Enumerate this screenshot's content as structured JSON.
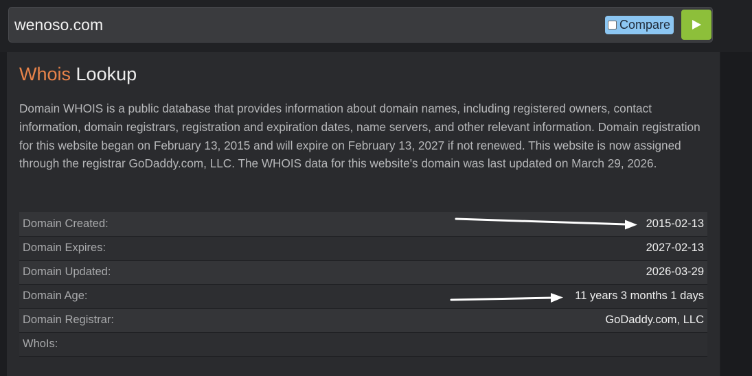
{
  "search": {
    "value": "wenoso.com",
    "compare_label": "Compare",
    "compare_checked": false,
    "go_icon": "play-triangle-icon"
  },
  "section": {
    "title_accent": "Whois",
    "title_rest": "Lookup",
    "description": "Domain WHOIS is a public database that provides information about domain names, including registered owners, contact information, domain registrars, registration and expiration dates, name servers, and other relevant information. Domain registration for this website began on February 13, 2015 and will expire on February 13, 2027 if not renewed. This website is now assigned through the registrar GoDaddy.com, LLC. The WHOIS data for this website's domain was last updated on March 29, 2026."
  },
  "table": {
    "rows": [
      {
        "label": "Domain Created:",
        "value": "2015-02-13"
      },
      {
        "label": "Domain Expires:",
        "value": "2027-02-13"
      },
      {
        "label": "Domain Updated:",
        "value": "2026-03-29"
      },
      {
        "label": "Domain Age:",
        "value": "11 years 3 months 1 days"
      },
      {
        "label": "Domain Registrar:",
        "value": "GoDaddy.com, LLC"
      },
      {
        "label": "WhoIs:",
        "value": ""
      }
    ]
  },
  "annotations": {
    "arrow_color": "#ffffff",
    "arrow_targets": [
      "Domain Created:",
      "Domain Age:"
    ]
  },
  "colors": {
    "accent": "#e8834a",
    "go_button": "#8dbf3a",
    "compare_bg": "#8cc6f2"
  }
}
